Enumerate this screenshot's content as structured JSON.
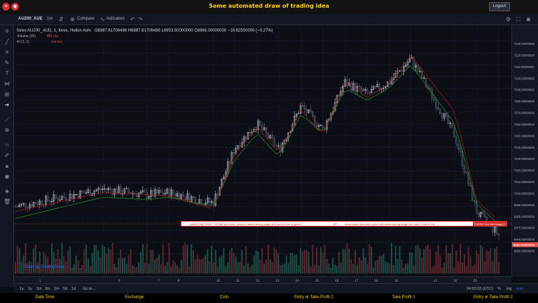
{
  "app": {
    "title": "Some automated draw of trading idea",
    "logout_label": "Logout"
  },
  "toolbar": {
    "symbol": "AU200_AUE",
    "interval": "1m",
    "compare_label": "Compare",
    "indicators_label": "Indicators"
  },
  "legend": {
    "main": "forex:AU200_AUD, 1, forex, Heikin Ashi",
    "ohlc": "O6987.61706486 H6987.61706486 L6953.50000000 C6966.00000000 −18.62500000 (−0.27%)",
    "volume": "Volume (20)",
    "volume_vals": "481  n/a",
    "ai": "AI (1, 1)",
    "ai_vals": "n/a  n/a"
  },
  "price_axis": {
    "ticks": [
      "7130.00000000",
      "7120.00000000",
      "7110.00000000",
      "7100.00000000",
      "7090.00000000",
      "7080.00000000",
      "7070.00000000",
      "7060.00000000",
      "7050.00000000",
      "7040.00000000",
      "7030.00000000",
      "7020.00000000",
      "7010.00000000",
      "7000.00000000",
      "6990.00000000",
      "6980.00000000",
      "6970.00000000",
      "6960.00000000",
      "6950.00000000"
    ],
    "current_label": "6966.00000000"
  },
  "time_axis": {
    "ticks": [
      "1",
      "5",
      "7",
      "8",
      "10",
      "11",
      "12",
      "13",
      "14",
      "15",
      "16",
      "17",
      "18",
      "19",
      "21",
      "22",
      "23"
    ]
  },
  "rangebar": {
    "ranges": [
      "1y",
      "1y",
      "1m",
      "3m",
      "1m",
      "5d",
      "1d",
      "Go to..."
    ],
    "clock": "04:53:32 (UTC)",
    "pct": "%",
    "log": "log",
    "auto": "auto"
  },
  "banner": {
    "text1": "Wait till flip ENDS  ↑  DRAW just when: price is above strong angle line and #1 line is green",
    "text2": "OR",
    "text3": "draw shorts just when price still below strong angle line and #1 line is red",
    "tag": "THERE Goo Bet maga H"
  },
  "tv_logo": "Chart by TradingView",
  "bottombar": {
    "columns": [
      "Date Time",
      "Exchange",
      "Coin",
      "Entry or Take Profit 2",
      "Take Profit 1",
      "Entry or Take Profit 2"
    ]
  },
  "colors": {
    "up": "#26a69a",
    "down": "#ef5350",
    "accent": "#ffd200"
  },
  "chart_data": {
    "type": "line",
    "title": "",
    "x": [
      1,
      5,
      7,
      8,
      10,
      11,
      12,
      13,
      14,
      15,
      16,
      17,
      18,
      19,
      21,
      22,
      23
    ],
    "series": [
      {
        "values": [
          6990,
          7005,
          7000,
          7002,
          6993,
          7040,
          7060,
          7038,
          7075,
          7055,
          7095,
          7085,
          7095,
          7115,
          7050,
          6985,
          6966
        ]
      },
      {
        "values": [
          6980,
          6998,
          6996,
          6998,
          6990,
          7030,
          7052,
          7032,
          7068,
          7052,
          7090,
          7080,
          7090,
          7110,
          7060,
          6992,
          6975
        ]
      },
      {
        "values": [
          6986,
          7002,
          7000,
          6999,
          6988,
          7035,
          7058,
          7035,
          7072,
          7050,
          7098,
          7082,
          7094,
          7118,
          7070,
          6995,
          6978
        ]
      }
    ],
    "ylim": [
      6950,
      7135
    ]
  }
}
